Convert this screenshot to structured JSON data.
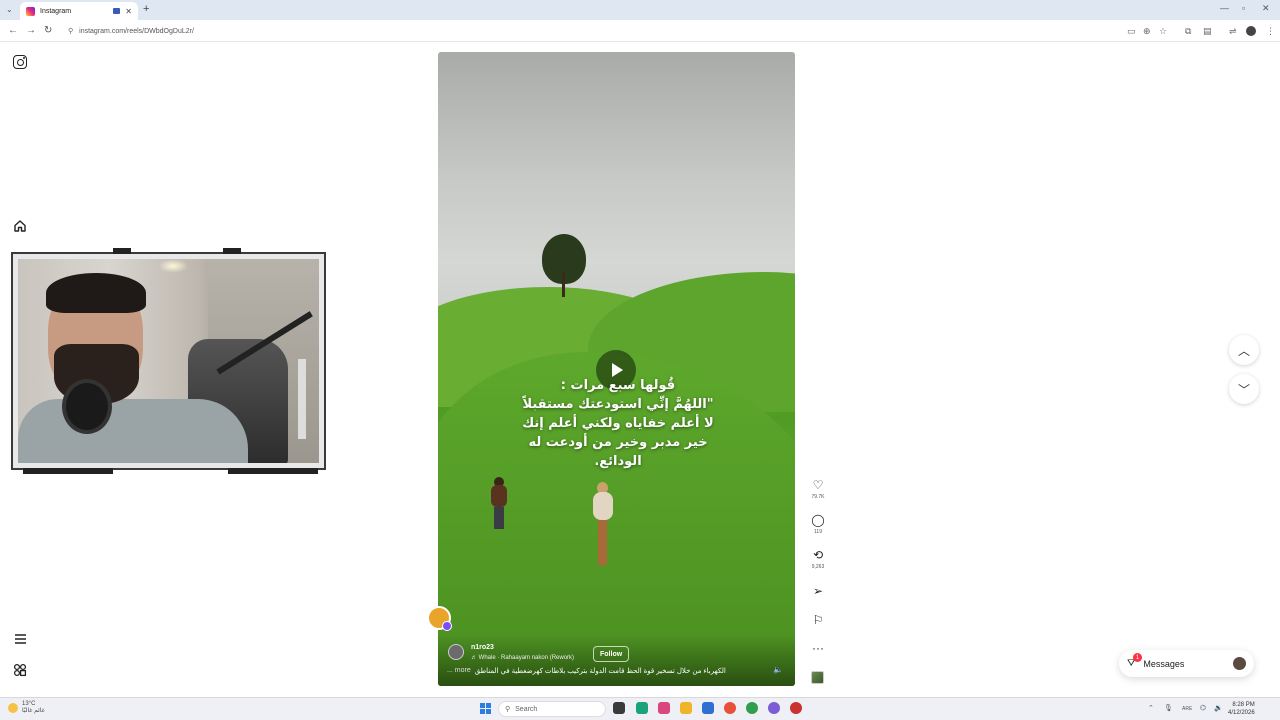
{
  "browser": {
    "tab_title": "Instagram",
    "url": "instagram.com/reels/DWbdOgDuL2r/",
    "new_tab": "+",
    "tab_close": "✕"
  },
  "instagram": {
    "reel": {
      "quote_lines": [
        "قُولها سبع مرات :",
        "\"اللهُمَّ إنِّي استودعتك مستقبلاً",
        "لا أعلم خفاياه ولكني أعلم إنك",
        "خير مدبر وخير من أودعت له",
        "الودائع."
      ],
      "username": "n1ro23",
      "music": "Whale · Rahaayam nakon (Rework)",
      "follow_label": "Follow",
      "caption": "الكهرباء من خلال تسخير قوة الحظ قامت الدولة بتركيب بلاطات كهرضغطية في المناطق",
      "more_label": "... more"
    },
    "actions": {
      "likes": "79.7K",
      "comments": "119",
      "reposts": "9,263"
    },
    "messages": {
      "label": "Messages",
      "badge": "1"
    }
  },
  "taskbar": {
    "weather_temp": "13°C",
    "weather_text": "غائم غالبًا",
    "search_placeholder": "Search",
    "lang": "ARE",
    "time": "8:28 PM",
    "date": "4/12/2026"
  }
}
